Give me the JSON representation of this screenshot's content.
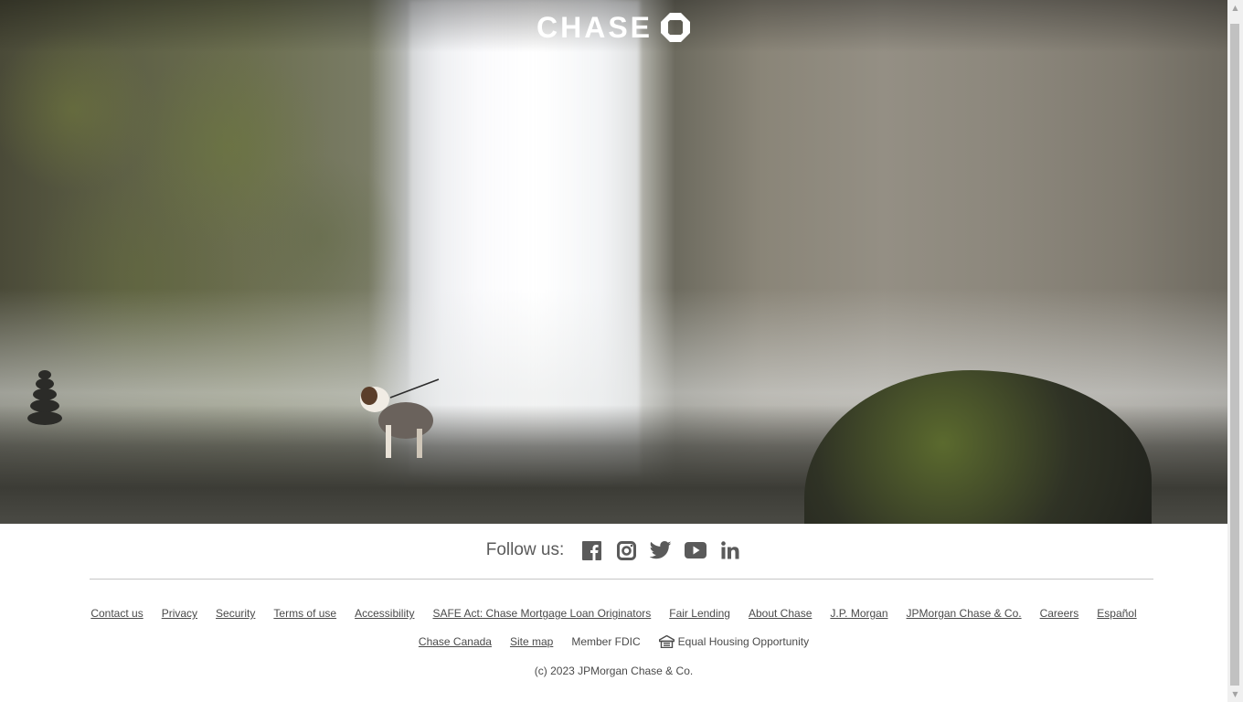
{
  "brand": {
    "name": "CHASE",
    "logo_icon": "chase-octagon-icon"
  },
  "follow": {
    "label": "Follow us:",
    "icons": [
      "facebook-icon",
      "instagram-icon",
      "twitter-icon",
      "youtube-icon",
      "linkedin-icon"
    ]
  },
  "footer": {
    "row1": [
      "Contact us",
      "Privacy",
      "Security",
      "Terms of use",
      "Accessibility",
      "SAFE Act: Chase Mortgage Loan Originators",
      "Fair Lending",
      "About Chase",
      "J.P. Morgan",
      "JPMorgan Chase & Co.",
      "Careers",
      "Español"
    ],
    "row2": {
      "chase_canada": "Chase Canada",
      "site_map": "Site map",
      "member_fdic": "Member FDIC",
      "equal_housing": "Equal Housing Opportunity"
    },
    "copyright": "(c) 2023 JPMorgan Chase & Co."
  },
  "colors": {
    "text": "#4a4a4a",
    "icon": "#5a5a5a",
    "divider": "#c7c7c7"
  }
}
